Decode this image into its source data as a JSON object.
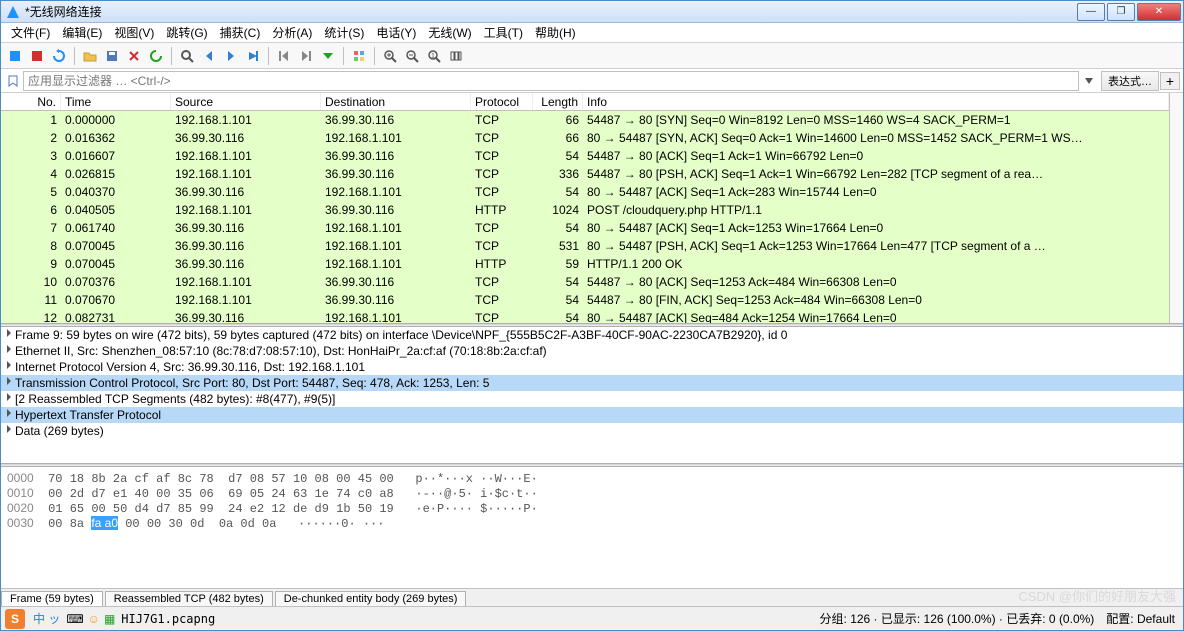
{
  "titlebar": {
    "text": "*无线网络连接"
  },
  "menu": [
    "文件(F)",
    "编辑(E)",
    "视图(V)",
    "跳转(G)",
    "捕获(C)",
    "分析(A)",
    "统计(S)",
    "电话(Y)",
    "无线(W)",
    "工具(T)",
    "帮助(H)"
  ],
  "filter": {
    "placeholder": "应用显示过滤器 … <Ctrl-/>",
    "expr_btn": "表达式…"
  },
  "columns": {
    "no": "No.",
    "time": "Time",
    "src": "Source",
    "dst": "Destination",
    "proto": "Protocol",
    "len": "Length",
    "info": "Info"
  },
  "packets": [
    {
      "no": "1",
      "time": "0.000000",
      "src": "192.168.1.101",
      "dst": "36.99.30.116",
      "proto": "TCP",
      "len": "66",
      "info": "54487 → 80 [SYN] Seq=0 Win=8192 Len=0 MSS=1460 WS=4 SACK_PERM=1",
      "cls": "green"
    },
    {
      "no": "2",
      "time": "0.016362",
      "src": "36.99.30.116",
      "dst": "192.168.1.101",
      "proto": "TCP",
      "len": "66",
      "info": "80 → 54487 [SYN, ACK] Seq=0 Ack=1 Win=14600 Len=0 MSS=1452 SACK_PERM=1 WS…",
      "cls": "green"
    },
    {
      "no": "3",
      "time": "0.016607",
      "src": "192.168.1.101",
      "dst": "36.99.30.116",
      "proto": "TCP",
      "len": "54",
      "info": "54487 → 80 [ACK] Seq=1 Ack=1 Win=66792 Len=0",
      "cls": "green"
    },
    {
      "no": "4",
      "time": "0.026815",
      "src": "192.168.1.101",
      "dst": "36.99.30.116",
      "proto": "TCP",
      "len": "336",
      "info": "54487 → 80 [PSH, ACK] Seq=1 Ack=1 Win=66792 Len=282 [TCP segment of a rea…",
      "cls": "green"
    },
    {
      "no": "5",
      "time": "0.040370",
      "src": "36.99.30.116",
      "dst": "192.168.1.101",
      "proto": "TCP",
      "len": "54",
      "info": "80 → 54487 [ACK] Seq=1 Ack=283 Win=15744 Len=0",
      "cls": "green"
    },
    {
      "no": "6",
      "time": "0.040505",
      "src": "192.168.1.101",
      "dst": "36.99.30.116",
      "proto": "HTTP",
      "len": "1024",
      "info": "POST /cloudquery.php HTTP/1.1",
      "cls": "green"
    },
    {
      "no": "7",
      "time": "0.061740",
      "src": "36.99.30.116",
      "dst": "192.168.1.101",
      "proto": "TCP",
      "len": "54",
      "info": "80 → 54487 [ACK] Seq=1 Ack=1253 Win=17664 Len=0",
      "cls": "green"
    },
    {
      "no": "8",
      "time": "0.070045",
      "src": "36.99.30.116",
      "dst": "192.168.1.101",
      "proto": "TCP",
      "len": "531",
      "info": "80 → 54487 [PSH, ACK] Seq=1 Ack=1253 Win=17664 Len=477 [TCP segment of a …",
      "cls": "green"
    },
    {
      "no": "9",
      "time": "0.070045",
      "src": "36.99.30.116",
      "dst": "192.168.1.101",
      "proto": "HTTP",
      "len": "59",
      "info": "HTTP/1.1 200 OK",
      "cls": "green"
    },
    {
      "no": "10",
      "time": "0.070376",
      "src": "192.168.1.101",
      "dst": "36.99.30.116",
      "proto": "TCP",
      "len": "54",
      "info": "54487 → 80 [ACK] Seq=1253 Ack=484 Win=66308 Len=0",
      "cls": "green"
    },
    {
      "no": "11",
      "time": "0.070670",
      "src": "192.168.1.101",
      "dst": "36.99.30.116",
      "proto": "TCP",
      "len": "54",
      "info": "54487 → 80 [FIN, ACK] Seq=1253 Ack=484 Win=66308 Len=0",
      "cls": "green"
    },
    {
      "no": "12",
      "time": "0.082731",
      "src": "36.99.30.116",
      "dst": "192.168.1.101",
      "proto": "TCP",
      "len": "54",
      "info": "80 → 54487 [ACK] Seq=484 Ack=1254 Win=17664 Len=0",
      "cls": "green"
    }
  ],
  "details": [
    {
      "text": "Frame 9: 59 bytes on wire (472 bits), 59 bytes captured (472 bits) on interface \\Device\\NPF_{555B5C2F-A3BF-40CF-90AC-2230CA7B2920}, id 0",
      "hl": false
    },
    {
      "text": "Ethernet II, Src: Shenzhen_08:57:10 (8c:78:d7:08:57:10), Dst: HonHaiPr_2a:cf:af (70:18:8b:2a:cf:af)",
      "hl": false
    },
    {
      "text": "Internet Protocol Version 4, Src: 36.99.30.116, Dst: 192.168.1.101",
      "hl": false
    },
    {
      "text": "Transmission Control Protocol, Src Port: 80, Dst Port: 54487, Seq: 478, Ack: 1253, Len: 5",
      "hl": true
    },
    {
      "text": "[2 Reassembled TCP Segments (482 bytes): #8(477), #9(5)]",
      "hl": false
    },
    {
      "text": "Hypertext Transfer Protocol",
      "hl": true
    },
    {
      "text": "Data (269 bytes)",
      "hl": false
    }
  ],
  "hex": [
    {
      "off": "0000",
      "bytes": "70 18 8b 2a cf af 8c 78  d7 08 57 10 08 00 45 00",
      "ascii": "p··*···x ··W···E·"
    },
    {
      "off": "0010",
      "bytes": "00 2d d7 e1 40 00 35 06  69 05 24 63 1e 74 c0 a8",
      "ascii": "·-··@·5· i·$c·t··"
    },
    {
      "off": "0020",
      "bytes": "01 65 00 50 d4 d7 85 99  24 e2 12 de d9 1b 50 19",
      "ascii": "·e·P···· $·····P·"
    },
    {
      "off": "0030",
      "bytes": "00 8a ",
      "hlbytes": "fa a0",
      "rest": " 00 00 30 0d  0a 0d 0a",
      "ascii": "······0· ···"
    }
  ],
  "tabs": [
    {
      "label": "Frame (59 bytes)",
      "active": true
    },
    {
      "label": "Reassembled TCP (482 bytes)",
      "active": false
    },
    {
      "label": "De-chunked entity body (269 bytes)",
      "active": false
    }
  ],
  "statusbar": {
    "file": "HIJ7G1.pcapng",
    "pkts": "分组: 126 · 已显示: 126 (100.0%) · 已丢弃: 0 (0.0%)",
    "profile": "配置: Default"
  },
  "watermark": "CSDN @你们的好朋友大强"
}
